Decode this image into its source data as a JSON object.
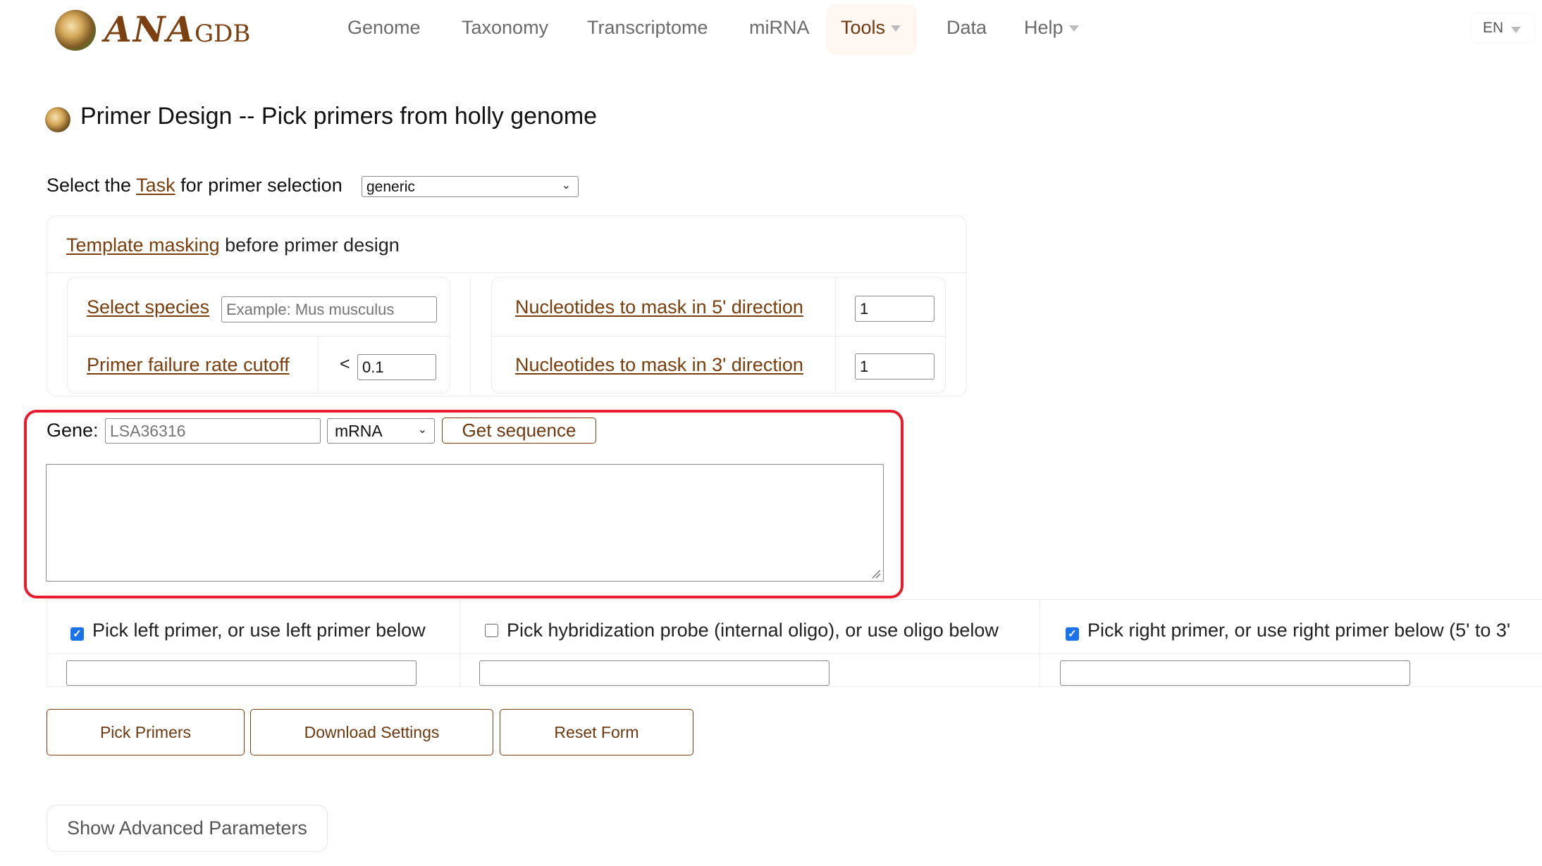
{
  "header": {
    "logo_main": "ANA",
    "logo_sub": "GDB",
    "nav": [
      {
        "label": "Genome",
        "has_dropdown": false
      },
      {
        "label": "Taxonomy",
        "has_dropdown": false
      },
      {
        "label": "Transcriptome",
        "has_dropdown": false
      },
      {
        "label": "miRNA",
        "has_dropdown": false
      },
      {
        "label": "Tools",
        "has_dropdown": true,
        "active": true
      },
      {
        "label": "Data",
        "has_dropdown": false
      },
      {
        "label": "Help",
        "has_dropdown": true
      }
    ],
    "language": "EN"
  },
  "page": {
    "title": "Primer Design -- Pick primers from holly genome"
  },
  "task": {
    "prefix": "Select the ",
    "link": "Task",
    "suffix": " for primer selection",
    "selected": "generic"
  },
  "masking": {
    "header_link": "Template masking",
    "header_suffix": " before primer design",
    "species_label": "Select species",
    "species_placeholder": "Example: Mus musculus",
    "species_value": "",
    "failure_label": "Primer failure rate cutoff",
    "failure_op": "<",
    "failure_value": "0.1",
    "mask5_label": "Nucleotides to mask in 5' direction",
    "mask5_value": "1",
    "mask3_label": "Nucleotides to mask in 3' direction",
    "mask3_value": "1"
  },
  "gene": {
    "label": "Gene:",
    "placeholder": "LSA36316",
    "value": "",
    "seq_type": "mRNA",
    "get_button": "Get sequence",
    "sequence": ""
  },
  "primers": {
    "left": {
      "label": "Pick left primer, or use left primer below",
      "checked": true,
      "value": ""
    },
    "probe": {
      "label": "Pick hybridization probe (internal oligo), or use oligo below",
      "checked": false,
      "value": ""
    },
    "right": {
      "label": "Pick right primer, or use right primer below (5' to 3'",
      "checked": true,
      "value": ""
    }
  },
  "actions": {
    "pick": "Pick Primers",
    "download": "Download Settings",
    "reset": "Reset Form",
    "advanced": "Show Advanced Parameters"
  },
  "colors": {
    "brand_brown": "#7a3e0c",
    "highlight_red": "#e81c2c",
    "checkbox_blue": "#1a73e8",
    "active_nav_bg": "#fff7f1"
  }
}
